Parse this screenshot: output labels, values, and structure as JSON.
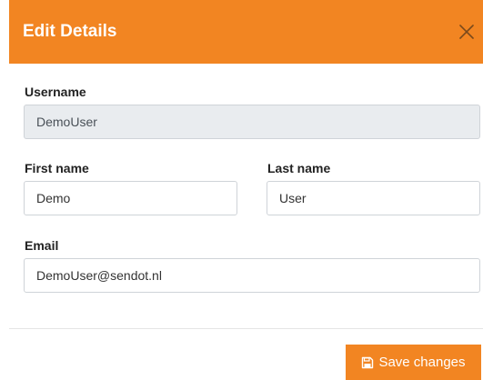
{
  "modal": {
    "title": "Edit Details",
    "close_icon": "close-icon"
  },
  "form": {
    "username": {
      "label": "Username",
      "value": "DemoUser"
    },
    "first_name": {
      "label": "First name",
      "value": "Demo"
    },
    "last_name": {
      "label": "Last name",
      "value": "User"
    },
    "email": {
      "label": "Email",
      "value": "DemoUser@sendot.nl"
    }
  },
  "footer": {
    "save_label": "Save changes",
    "save_icon": "save-icon"
  },
  "colors": {
    "accent": "#f28522",
    "readonly_bg": "#e9ecef",
    "border": "#cfd3d8"
  }
}
